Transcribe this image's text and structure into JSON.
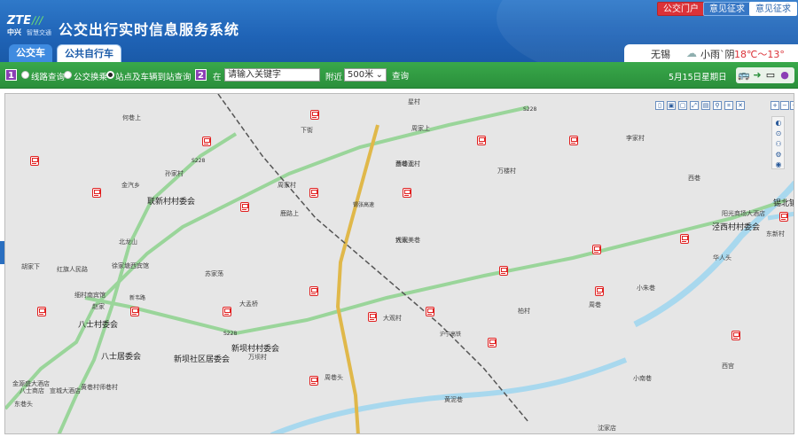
{
  "header": {
    "logo_text": "ZTE",
    "logo_sub": "中兴",
    "logo_sub2": "智慧交通",
    "title": "公交出行实时信息服务系统",
    "btn_portal": "公交门户",
    "btn_feedback1": "意见征求",
    "btn_feedback2": "意见征求"
  },
  "tabs": {
    "bus": "公交车",
    "bike": "公共自行车"
  },
  "weather": {
    "city": "无锡",
    "icon": "rain-cloud-icon",
    "desc": "小雨`阴",
    "temp": "18℃～13°"
  },
  "toolbar": {
    "step1": "1",
    "step2": "2",
    "opt1": "线路查询",
    "opt2": "公交换乘",
    "opt3": "站点及车辆到站查询",
    "in_label": "在",
    "search_placeholder": "请输入关键字",
    "near_label": "附近",
    "radius": "500米",
    "query": "查询",
    "date": "5月15日星期日",
    "colors": {
      "green": "#2a8f3b",
      "purple": "#8b3fb5"
    }
  },
  "map": {
    "labels": [
      {
        "text": "何巷上",
        "cls": ""
      },
      {
        "text": "下街",
        "cls": ""
      },
      {
        "text": "星村",
        "cls": ""
      },
      {
        "text": "孙家村",
        "cls": ""
      },
      {
        "text": "联新村村委会",
        "cls": "big"
      },
      {
        "text": "周家村",
        "cls": ""
      },
      {
        "text": "西峰观村",
        "cls": ""
      },
      {
        "text": "金汽乡",
        "cls": ""
      },
      {
        "text": "鹿路上",
        "cls": ""
      },
      {
        "text": "北龙山",
        "cls": ""
      },
      {
        "text": "苏家荡",
        "cls": ""
      },
      {
        "text": "胡家下",
        "cls": ""
      },
      {
        "text": "红旗人民路",
        "cls": ""
      },
      {
        "text": "徐家塘西宾馆",
        "cls": ""
      },
      {
        "text": "细村南宾馆",
        "cls": ""
      },
      {
        "text": "赵家",
        "cls": ""
      },
      {
        "text": "八士村委会",
        "cls": "big"
      },
      {
        "text": "大孟桥",
        "cls": ""
      },
      {
        "text": "八士居委会",
        "cls": "big"
      },
      {
        "text": "新坝社区居委会",
        "cls": "big"
      },
      {
        "text": "新坝村村委会",
        "cls": "big"
      },
      {
        "text": "万坝村",
        "cls": ""
      },
      {
        "text": "钱家",
        "cls": ""
      },
      {
        "text": "大观美巷",
        "cls": ""
      },
      {
        "text": "柏村",
        "cls": ""
      },
      {
        "text": "大观村",
        "cls": ""
      },
      {
        "text": "周巷头",
        "cls": ""
      },
      {
        "text": "黄泥巷",
        "cls": ""
      },
      {
        "text": "李家村",
        "cls": ""
      },
      {
        "text": "万楼村",
        "cls": ""
      },
      {
        "text": "萧巷上",
        "cls": ""
      },
      {
        "text": "周家上",
        "cls": ""
      },
      {
        "text": "西巷",
        "cls": ""
      },
      {
        "text": "锡北镇",
        "cls": "big"
      },
      {
        "text": "阳光商场大酒店",
        "cls": ""
      },
      {
        "text": "泾西村村委会",
        "cls": "big"
      },
      {
        "text": "东新村",
        "cls": ""
      },
      {
        "text": "华人头",
        "cls": ""
      },
      {
        "text": "小朱巷",
        "cls": ""
      },
      {
        "text": "周巷",
        "cls": ""
      },
      {
        "text": "小南巷",
        "cls": ""
      },
      {
        "text": "西宫",
        "cls": ""
      },
      {
        "text": "金源盛大酒店",
        "cls": ""
      },
      {
        "text": "八士商店",
        "cls": ""
      },
      {
        "text": "宣城大酒店",
        "cls": ""
      },
      {
        "text": "黄巷村",
        "cls": ""
      },
      {
        "text": "师巷村",
        "cls": ""
      },
      {
        "text": "沈家店",
        "cls": ""
      },
      {
        "text": "东巷头",
        "cls": ""
      }
    ],
    "roads": [
      {
        "text": "S228"
      },
      {
        "text": "S228"
      },
      {
        "text": "锡张高速"
      },
      {
        "text": "沪宁高铁"
      },
      {
        "text": "S228"
      },
      {
        "text": "新韦路"
      }
    ]
  }
}
